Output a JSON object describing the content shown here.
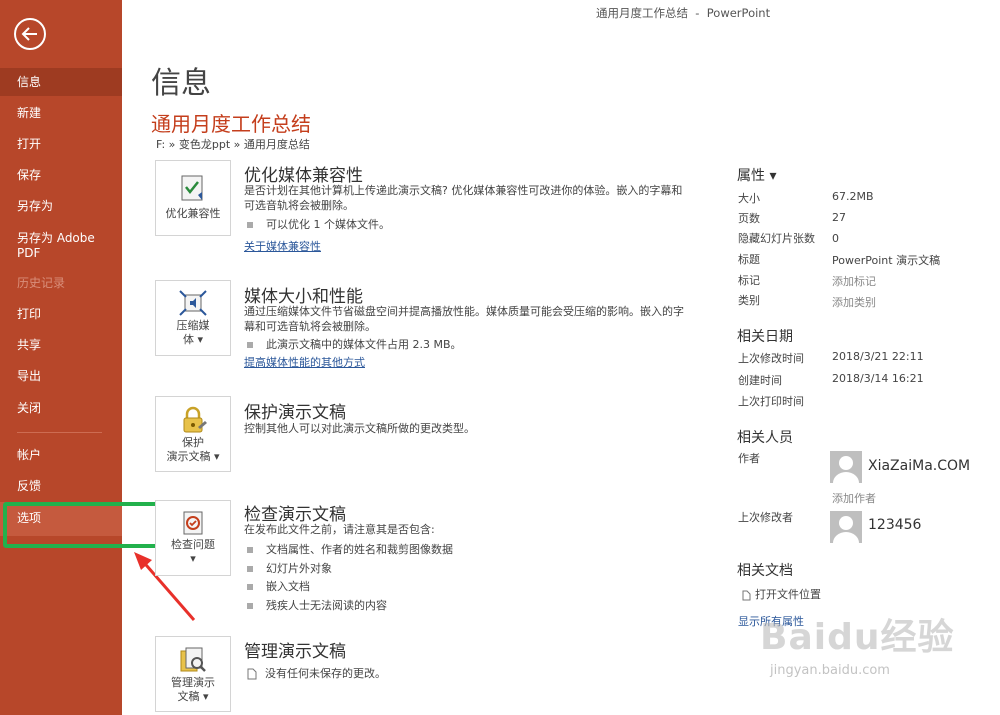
{
  "window": {
    "title": "通用月度工作总结  -  PowerPoint"
  },
  "sidebar": {
    "items": [
      {
        "label": "信息"
      },
      {
        "label": "新建"
      },
      {
        "label": "打开"
      },
      {
        "label": "保存"
      },
      {
        "label": "另存为"
      },
      {
        "label": "另存为 Adobe\nPDF"
      },
      {
        "label": "历史记录"
      },
      {
        "label": "打印"
      },
      {
        "label": "共享"
      },
      {
        "label": "导出"
      },
      {
        "label": "关闭"
      },
      {
        "label": "帐户"
      },
      {
        "label": "反馈"
      },
      {
        "label": "选项"
      }
    ]
  },
  "page": {
    "title": "信息",
    "doc_title": "通用月度工作总结",
    "path": "F: » 变色龙ppt » 通用月度总结"
  },
  "sections": {
    "compat": {
      "tile_label": "优化兼容性",
      "title": "优化媒体兼容性",
      "desc": "是否计划在其他计算机上传递此演示文稿? 优化媒体兼容性可改进你的体验。嵌入的字幕和可选音轨将会被删除。",
      "bullet": "可以优化 1 个媒体文件。",
      "link": "关于媒体兼容性"
    },
    "compress": {
      "tile_label1": "压缩媒",
      "tile_label2": "体 ▾",
      "title": "媒体大小和性能",
      "desc": "通过压缩媒体文件节省磁盘空间并提高播放性能。媒体质量可能会受压缩的影响。嵌入的字幕和可选音轨将会被删除。",
      "bullet": "此演示文稿中的媒体文件占用 2.3 MB。",
      "link": "提高媒体性能的其他方式"
    },
    "protect": {
      "tile_label1": "保护",
      "tile_label2": "演示文稿 ▾",
      "title": "保护演示文稿",
      "desc": "控制其他人可以对此演示文稿所做的更改类型。"
    },
    "inspect": {
      "tile_label1": "检查问题",
      "tile_label2": "▾",
      "title": "检查演示文稿",
      "desc": "在发布此文件之前，请注意其是否包含:",
      "bullets": [
        "文档属性、作者的姓名和裁剪图像数据",
        "幻灯片外对象",
        "嵌入文档",
        "残疾人士无法阅读的内容"
      ]
    },
    "manage": {
      "tile_label1": "管理演示",
      "tile_label2": "文稿 ▾",
      "title": "管理演示文稿",
      "desc": "没有任何未保存的更改。"
    }
  },
  "properties": {
    "heading": "属性 ▾",
    "rows": [
      {
        "label": "大小",
        "value": "67.2MB"
      },
      {
        "label": "页数",
        "value": "27"
      },
      {
        "label": "隐藏幻灯片张数",
        "value": "0"
      },
      {
        "label": "标题",
        "value": "PowerPoint 演示文稿"
      },
      {
        "label": "标记",
        "value": "添加标记"
      },
      {
        "label": "类别",
        "value": "添加类别"
      }
    ]
  },
  "dates": {
    "heading": "相关日期",
    "rows": [
      {
        "label": "上次修改时间",
        "value": "2018/3/21 22:11"
      },
      {
        "label": "创建时间",
        "value": "2018/3/14 16:21"
      },
      {
        "label": "上次打印时间",
        "value": ""
      }
    ]
  },
  "people": {
    "heading": "相关人员",
    "author_label": "作者",
    "author_name": "XiaZaiMa.COM",
    "add_author": "添加作者",
    "modifier_label": "上次修改者",
    "modifier_name": "123456"
  },
  "related_docs": {
    "heading": "相关文档",
    "open_location": "打开文件位置",
    "show_all": "显示所有属性"
  },
  "watermark": {
    "text": "Baidu经验",
    "sub": "jingyan.baidu.com"
  },
  "colors": {
    "sidebar": "#b7472a",
    "active": "#9e3b21",
    "accent": "#c43e1c",
    "highlight": "#22b14c",
    "arrow": "#e8302a"
  }
}
